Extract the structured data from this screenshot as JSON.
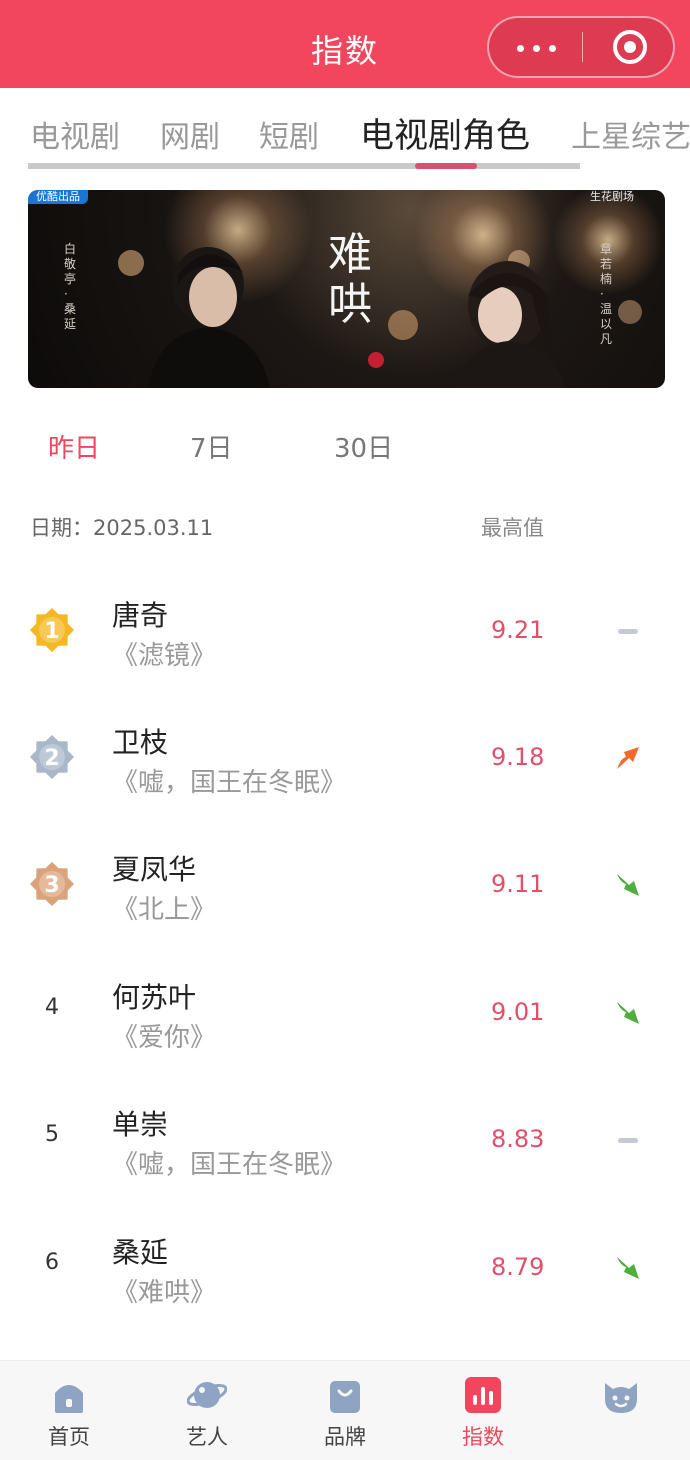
{
  "header": {
    "title": "指数"
  },
  "category_tabs": [
    "电视剧",
    "网剧",
    "短剧",
    "电视剧角色",
    "上星综艺"
  ],
  "category_active_index": 3,
  "banner": {
    "title_vertical": "难哄",
    "badge_left": "优酷出品",
    "badge_right": "生花剧场",
    "credit_left": "白敬亭·桑延",
    "credit_right": "章若楠·温以凡"
  },
  "period_tabs": [
    "昨日",
    "7日",
    "30日"
  ],
  "period_active_index": 0,
  "table": {
    "date_label": "日期：2025.03.11",
    "max_label": "最高值"
  },
  "rows": [
    {
      "rank": "1",
      "medal": "gold",
      "role": "唐奇",
      "show": "《滤镜》",
      "score": "9.21",
      "trend": "flat"
    },
    {
      "rank": "2",
      "medal": "silver",
      "role": "卫枝",
      "show": "《嘘，国王在冬眠》",
      "score": "9.18",
      "trend": "up"
    },
    {
      "rank": "3",
      "medal": "bronze",
      "role": "夏凤华",
      "show": "《北上》",
      "score": "9.11",
      "trend": "down"
    },
    {
      "rank": "4",
      "medal": "",
      "role": "何苏叶",
      "show": "《爱你》",
      "score": "9.01",
      "trend": "down"
    },
    {
      "rank": "5",
      "medal": "",
      "role": "单崇",
      "show": "《嘘，国王在冬眠》",
      "score": "8.83",
      "trend": "flat"
    },
    {
      "rank": "6",
      "medal": "",
      "role": "桑延",
      "show": "《难哄》",
      "score": "8.79",
      "trend": "down"
    }
  ],
  "colors": {
    "brand": "#f2465e",
    "score": "#e0506a",
    "trend_up": "#f06a2c",
    "trend_down": "#4fae3c",
    "trend_flat": "#c6c9d4",
    "medal_gold": "#f5b722",
    "medal_silver": "#a9b7c8",
    "medal_bronze": "#dba37a"
  },
  "bottom_nav": [
    {
      "label": "首页",
      "icon": "home-icon"
    },
    {
      "label": "艺人",
      "icon": "planet-icon"
    },
    {
      "label": "品牌",
      "icon": "shopping-bag-icon"
    },
    {
      "label": "指数",
      "icon": "bar-chart-icon"
    },
    {
      "label": "",
      "icon": "mascot-face-icon"
    }
  ],
  "bottom_nav_active_index": 3
}
